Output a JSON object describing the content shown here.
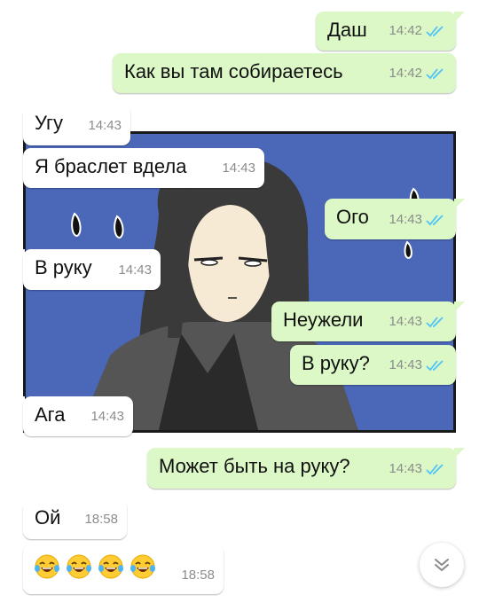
{
  "messages": [
    {
      "text": "Даш",
      "time": "14:42",
      "dir": "out"
    },
    {
      "text": "Как вы там собираетесь",
      "time": "14:42",
      "dir": "out"
    },
    {
      "text": "Угу",
      "time": "14:43",
      "dir": "in"
    },
    {
      "text": "Я браслет вдела",
      "time": "14:43",
      "dir": "in"
    },
    {
      "text": "Ого",
      "time": "14:43",
      "dir": "out"
    },
    {
      "text": "В руку",
      "time": "14:43",
      "dir": "in"
    },
    {
      "text": "Неужели",
      "time": "14:43",
      "dir": "out"
    },
    {
      "text": "В руку?",
      "time": "14:43",
      "dir": "out"
    },
    {
      "text": "Ага",
      "time": "14:43",
      "dir": "in"
    },
    {
      "text": "Может быть на руку?",
      "time": "14:43",
      "dir": "out"
    },
    {
      "text": "Ой",
      "time": "18:58",
      "dir": "in"
    },
    {
      "text": "",
      "time": "18:58",
      "dir": "in",
      "emojis": [
        "face-with-tears-of-joy",
        "face-with-tears-of-joy",
        "face-with-tears-of-joy",
        "face-with-tears-of-joy"
      ]
    }
  ],
  "colors": {
    "outgoing_bubble": "#dcf8c6",
    "incoming_bubble": "#ffffff",
    "read_ticks": "#4fc3f7",
    "timestamp": "#8c8c8c",
    "art_background": "#4a67b8"
  },
  "icons": {
    "read_receipt": "double-check-icon",
    "scroll_down": "double-chevron-down-icon"
  }
}
